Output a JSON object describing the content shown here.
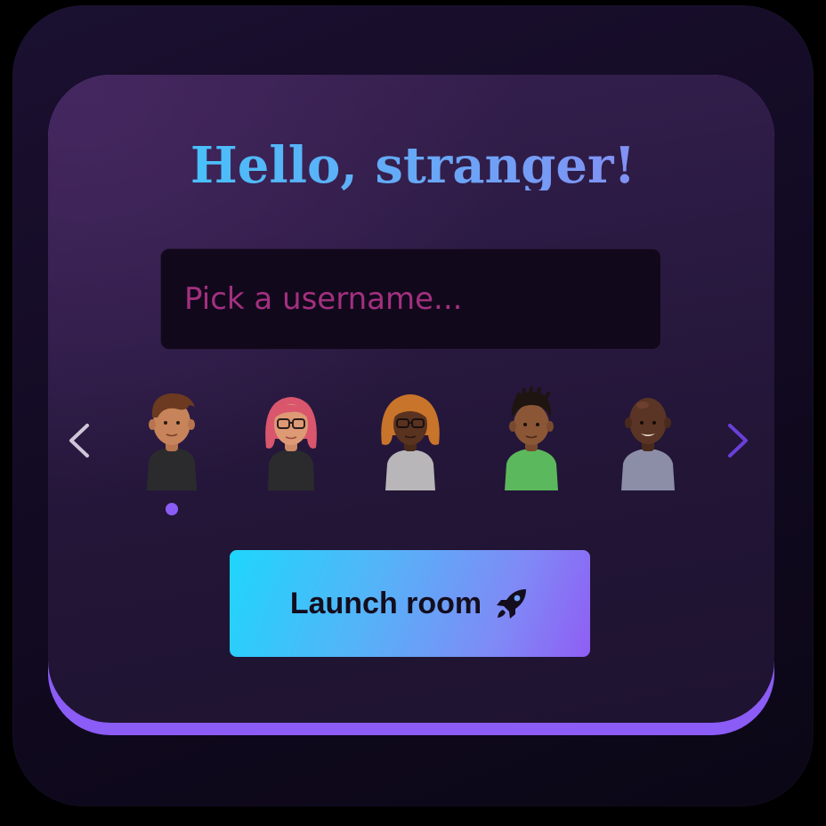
{
  "header": {
    "title": "Hello, stranger!"
  },
  "username": {
    "placeholder": "Pick a username...",
    "value": ""
  },
  "avatar_picker": {
    "selected_index": 0,
    "avatars": [
      {
        "label": "Avatar 1",
        "icon": "avatar-man-brown-hair-black-shirt"
      },
      {
        "label": "Avatar 2",
        "icon": "avatar-woman-pink-hair-glasses"
      },
      {
        "label": "Avatar 3",
        "icon": "avatar-woman-ginger-hair-glasses"
      },
      {
        "label": "Avatar 4",
        "icon": "avatar-man-locs-green-shirt"
      },
      {
        "label": "Avatar 5",
        "icon": "avatar-man-bald-grey-shirt"
      }
    ],
    "prev_icon": "chevron-left-icon",
    "next_icon": "chevron-right-icon"
  },
  "actions": {
    "launch_label": "Launch room",
    "launch_icon": "rocket-icon"
  },
  "colors": {
    "accent": "#8b5cf6",
    "title_gradient": [
      "#2fd4fb",
      "#9a7cf2"
    ],
    "button_gradient": [
      "#1ed6fb",
      "#8f5ef4"
    ],
    "placeholder": "#a3307f",
    "background": "#120a22"
  }
}
